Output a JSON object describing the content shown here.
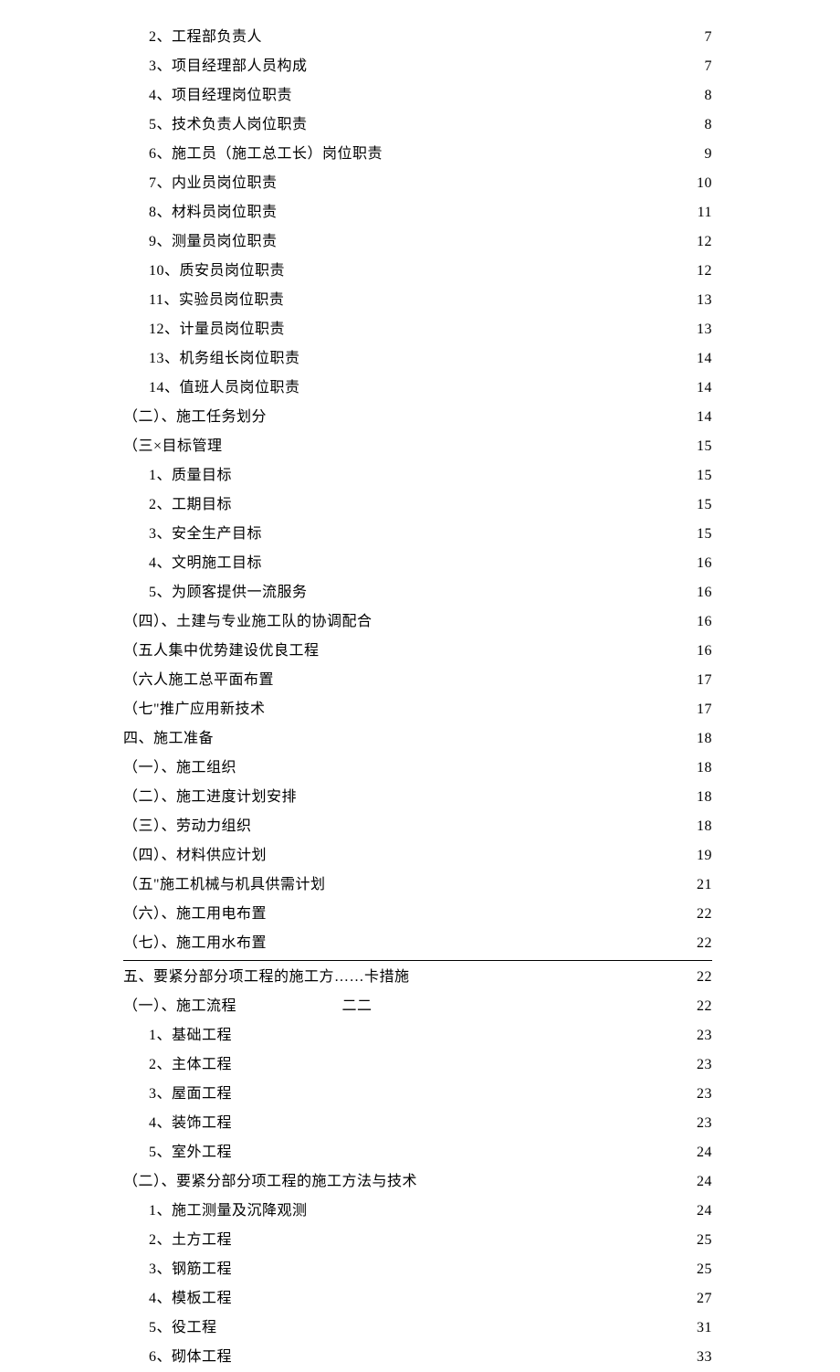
{
  "toc": [
    {
      "indent": 1,
      "label": "2、工程部负责人",
      "page": "7",
      "sep": false
    },
    {
      "indent": 1,
      "label": "3、项目经理部人员构成",
      "page": "7",
      "sep": false
    },
    {
      "indent": 1,
      "label": "4、项目经理岗位职责",
      "page": "8",
      "sep": false
    },
    {
      "indent": 1,
      "label": "5、技术负责人岗位职责",
      "page": "8",
      "sep": false
    },
    {
      "indent": 1,
      "label": "6、施工员（施工总工长）岗位职责",
      "page": "9",
      "sep": false
    },
    {
      "indent": 1,
      "label": "7、内业员岗位职责",
      "page": "10",
      "sep": false
    },
    {
      "indent": 1,
      "label": "8、材料员岗位职责",
      "page": "11",
      "sep": false
    },
    {
      "indent": 1,
      "label": "9、测量员岗位职责",
      "page": "12",
      "sep": false
    },
    {
      "indent": 1,
      "label": "10、质安员岗位职责",
      "page": "12",
      "sep": false
    },
    {
      "indent": 1,
      "label": "11、实验员岗位职责",
      "page": "13",
      "sep": false
    },
    {
      "indent": 1,
      "label": "12、计量员岗位职责",
      "page": "13",
      "sep": false
    },
    {
      "indent": 1,
      "label": "13、机务组长岗位职责",
      "page": "14",
      "sep": false
    },
    {
      "indent": 1,
      "label": "14、值班人员岗位职责",
      "page": "14",
      "sep": false
    },
    {
      "indent": 0,
      "label": "（二）、施工任务划分",
      "page": "14",
      "sep": false
    },
    {
      "indent": 0,
      "label": "（三×目标管理",
      "page": "15",
      "sep": false
    },
    {
      "indent": 1,
      "label": "1、质量目标",
      "page": "15",
      "sep": false
    },
    {
      "indent": 1,
      "label": "2、工期目标",
      "page": "15",
      "sep": false
    },
    {
      "indent": 1,
      "label": "3、安全生产目标",
      "page": "15",
      "sep": false
    },
    {
      "indent": 1,
      "label": "4、文明施工目标",
      "page": "16",
      "sep": false
    },
    {
      "indent": 1,
      "label": "5、为顾客提供一流服务",
      "page": "16",
      "sep": false
    },
    {
      "indent": 0,
      "label": "（四）、土建与专业施工队的协调配合",
      "page": "16",
      "sep": false
    },
    {
      "indent": 0,
      "label": "（五人集中优势建设优良工程",
      "page": "16",
      "sep": false
    },
    {
      "indent": 0,
      "label": "（六人施工总平面布置",
      "page": "17",
      "sep": false
    },
    {
      "indent": 0,
      "label": "（七\"推广应用新技术",
      "page": "17",
      "sep": false
    },
    {
      "indent": 0,
      "label": "四、施工准备",
      "page": "18",
      "sep": false
    },
    {
      "indent": 0,
      "label": "（一）、施工组织",
      "page": "18",
      "sep": false
    },
    {
      "indent": 0,
      "label": "（二）、施工进度计划安排",
      "page": "18",
      "sep": false
    },
    {
      "indent": 0,
      "label": "（三）、劳动力组织",
      "page": "18",
      "sep": false
    },
    {
      "indent": 0,
      "label": "（四）、材料供应计划",
      "page": "19",
      "sep": false
    },
    {
      "indent": 0,
      "label": "（五\"施工机械与机具供需计划",
      "page": "21",
      "sep": false
    },
    {
      "indent": 0,
      "label": "（六）、施工用电布置",
      "page": "22",
      "sep": false
    },
    {
      "indent": 0,
      "label": "（七）、施工用水布置",
      "page": "22",
      "sep": true
    },
    {
      "indent": 0,
      "label": "五、要紧分部分项工程的施工方……卡措施",
      "page": "22",
      "sep": false
    },
    {
      "indent": 0,
      "label": "（一）、施工流程       二二",
      "page": "22",
      "sep": false
    },
    {
      "indent": 1,
      "label": "1、基础工程",
      "page": "23",
      "sep": false
    },
    {
      "indent": 1,
      "label": "2、主体工程",
      "page": "23",
      "sep": false
    },
    {
      "indent": 1,
      "label": "3、屋面工程",
      "page": "23",
      "sep": false
    },
    {
      "indent": 1,
      "label": "4、装饰工程",
      "page": "23",
      "sep": false
    },
    {
      "indent": 1,
      "label": "5、室外工程",
      "page": "24",
      "sep": false
    },
    {
      "indent": 0,
      "label": "（二）、要紧分部分项工程的施工方法与技术",
      "page": "24",
      "sep": false
    },
    {
      "indent": 1,
      "label": "1、施工测量及沉降观测",
      "page": "24",
      "sep": false
    },
    {
      "indent": 1,
      "label": "2、土方工程",
      "page": "25",
      "sep": false
    },
    {
      "indent": 1,
      "label": "3、钢筋工程",
      "page": "25",
      "sep": false
    },
    {
      "indent": 1,
      "label": "4、模板工程",
      "page": "27",
      "sep": false
    },
    {
      "indent": 1,
      "label": "5、役工程",
      "page": "31",
      "sep": false
    },
    {
      "indent": 1,
      "label": "6、砌体工程",
      "page": "33",
      "sep": false
    }
  ]
}
